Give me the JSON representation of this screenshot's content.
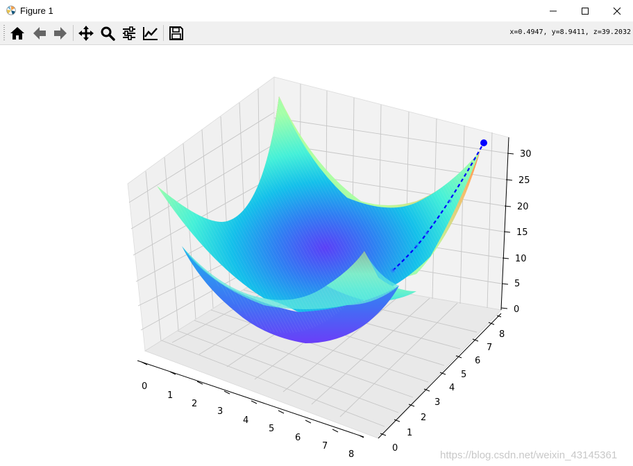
{
  "window": {
    "title": "Figure 1",
    "controls": [
      "minimize",
      "maximize",
      "close"
    ]
  },
  "toolbar": {
    "buttons": [
      {
        "name": "home-icon",
        "label": "Home"
      },
      {
        "name": "back-arrow-icon",
        "label": "Back"
      },
      {
        "name": "forward-arrow-icon",
        "label": "Forward"
      },
      {
        "name": "pan-move-icon",
        "label": "Pan"
      },
      {
        "name": "zoom-magnifier-icon",
        "label": "Zoom"
      },
      {
        "name": "configure-subplots-icon",
        "label": "Subplots"
      },
      {
        "name": "edit-axis-icon",
        "label": "Customize"
      },
      {
        "name": "save-floppy-icon",
        "label": "Save"
      }
    ],
    "coordinates": "x=0.4947, y=8.9411, z=39.2032"
  },
  "chart_data": {
    "type": "surface3d",
    "colormap": "rainbow",
    "x_ticks": [
      "0",
      "1",
      "2",
      "3",
      "4",
      "5",
      "6",
      "7",
      "8"
    ],
    "y_ticks": [
      "0",
      "1",
      "2",
      "3",
      "4",
      "5",
      "6",
      "7",
      "8"
    ],
    "z_ticks": [
      "0",
      "5",
      "10",
      "15",
      "20",
      "25",
      "30"
    ],
    "xlim": [
      0,
      8
    ],
    "ylim": [
      0,
      8
    ],
    "zlim": [
      0,
      32
    ],
    "surface": "paraboloid bowl, minimum near (4, 4), corners near z = 32",
    "path": {
      "style": "blue dashed line with circle markers",
      "color": "#0000ff",
      "end_point_z": 32
    },
    "grid": true
  },
  "watermark": "https://blog.csdn.net/weixin_43145361"
}
